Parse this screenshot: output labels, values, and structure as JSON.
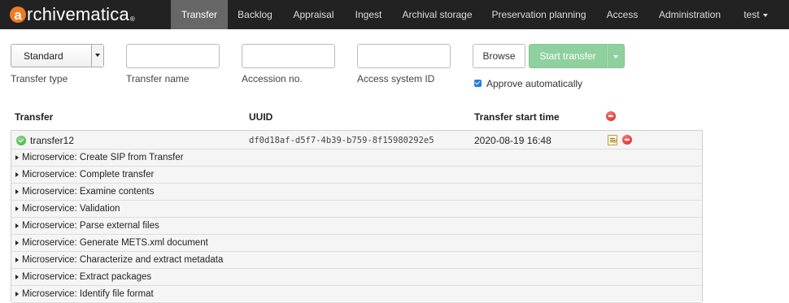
{
  "nav": {
    "brand_letter": "a",
    "brand_rest": "rchivematica",
    "brand_mark": "®",
    "items": [
      {
        "label": "Transfer",
        "active": true
      },
      {
        "label": "Backlog"
      },
      {
        "label": "Appraisal"
      },
      {
        "label": "Ingest"
      },
      {
        "label": "Archival storage"
      },
      {
        "label": "Preservation planning"
      },
      {
        "label": "Access"
      },
      {
        "label": "Administration"
      }
    ],
    "user": "test"
  },
  "form": {
    "transfer_type_value": "Standard",
    "transfer_type_label": "Transfer type",
    "transfer_name_label": "Transfer name",
    "transfer_name_value": "",
    "accession_label": "Accession no.",
    "accession_value": "",
    "access_id_label": "Access system ID",
    "access_id_value": "",
    "browse_label": "Browse",
    "start_label": "Start transfer",
    "approve_label": "Approve automatically",
    "approve_checked": true
  },
  "table": {
    "headers": {
      "transfer": "Transfer",
      "uuid": "UUID",
      "start_time": "Transfer start time"
    },
    "transfer": {
      "name": "transfer12",
      "uuid": "df0d18af-d5f7-4b39-b759-8f15980292e5",
      "start_time": "2020-08-19 16:48",
      "status": "completed"
    },
    "microservices": [
      "Microservice: Create SIP from Transfer",
      "Microservice: Complete transfer",
      "Microservice: Examine contents",
      "Microservice: Validation",
      "Microservice: Parse external files",
      "Microservice: Generate METS.xml document",
      "Microservice: Characterize and extract metadata",
      "Microservice: Extract packages",
      "Microservice: Identify file format"
    ]
  },
  "colors": {
    "navbar_bg": "#222222",
    "nav_active_bg": "#676767",
    "brand_accent": "#f07a21",
    "start_button": "#8fd19e",
    "remove_red": "#d91a1a",
    "ok_green": "#3aa63a"
  }
}
